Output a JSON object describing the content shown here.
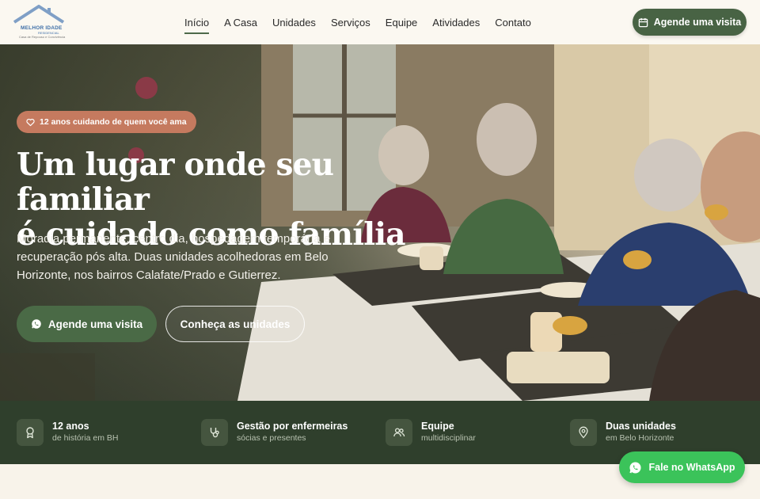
{
  "logo": {
    "line1": "MELHOR IDADE",
    "line2": "RESIDENCIAL",
    "line3": "Casa de Repouso e Convivência"
  },
  "nav": {
    "items": [
      {
        "label": "Início",
        "active": true
      },
      {
        "label": "A Casa"
      },
      {
        "label": "Unidades"
      },
      {
        "label": "Serviços"
      },
      {
        "label": "Equipe"
      },
      {
        "label": "Atividades"
      },
      {
        "label": "Contato"
      }
    ],
    "cta_label": "Agende uma visita",
    "cta_icon": "calendar-icon"
  },
  "hero": {
    "badge": "12 anos cuidando de quem você ama",
    "badge_icon": "heart-icon",
    "title_line1": "Um lugar onde seu familiar",
    "title_line2": "é cuidado como família",
    "subtitle": "Moradia permanente, centro dia, hospedagem temporária e recuperação pós alta. Duas unidades acolhedoras em Belo Horizonte, nos bairros Calafate/Prado e Gutierrez.",
    "primary_button": "Agende uma visita",
    "primary_icon": "whatsapp-icon",
    "secondary_button": "Conheça as unidades"
  },
  "features": [
    {
      "title": "12 anos",
      "subtitle": "de história em BH",
      "icon": "award-icon"
    },
    {
      "title": "Gestão por enfermeiras",
      "subtitle": "sócias e presentes",
      "icon": "stethoscope-icon"
    },
    {
      "title": "Equipe",
      "subtitle": "multidisciplinar",
      "icon": "users-icon"
    },
    {
      "title": "Duas unidades",
      "subtitle": "em Belo Horizonte",
      "icon": "map-pin-icon"
    }
  ],
  "whatsapp_float": {
    "label": "Fale no WhatsApp",
    "icon": "whatsapp-icon"
  },
  "colors": {
    "primary_green": "#486344",
    "dark_green": "#2f3f2c",
    "badge_terracotta": "#c57a5f",
    "whatsapp_green": "#3bc35a",
    "cream": "#fbf8f1"
  }
}
